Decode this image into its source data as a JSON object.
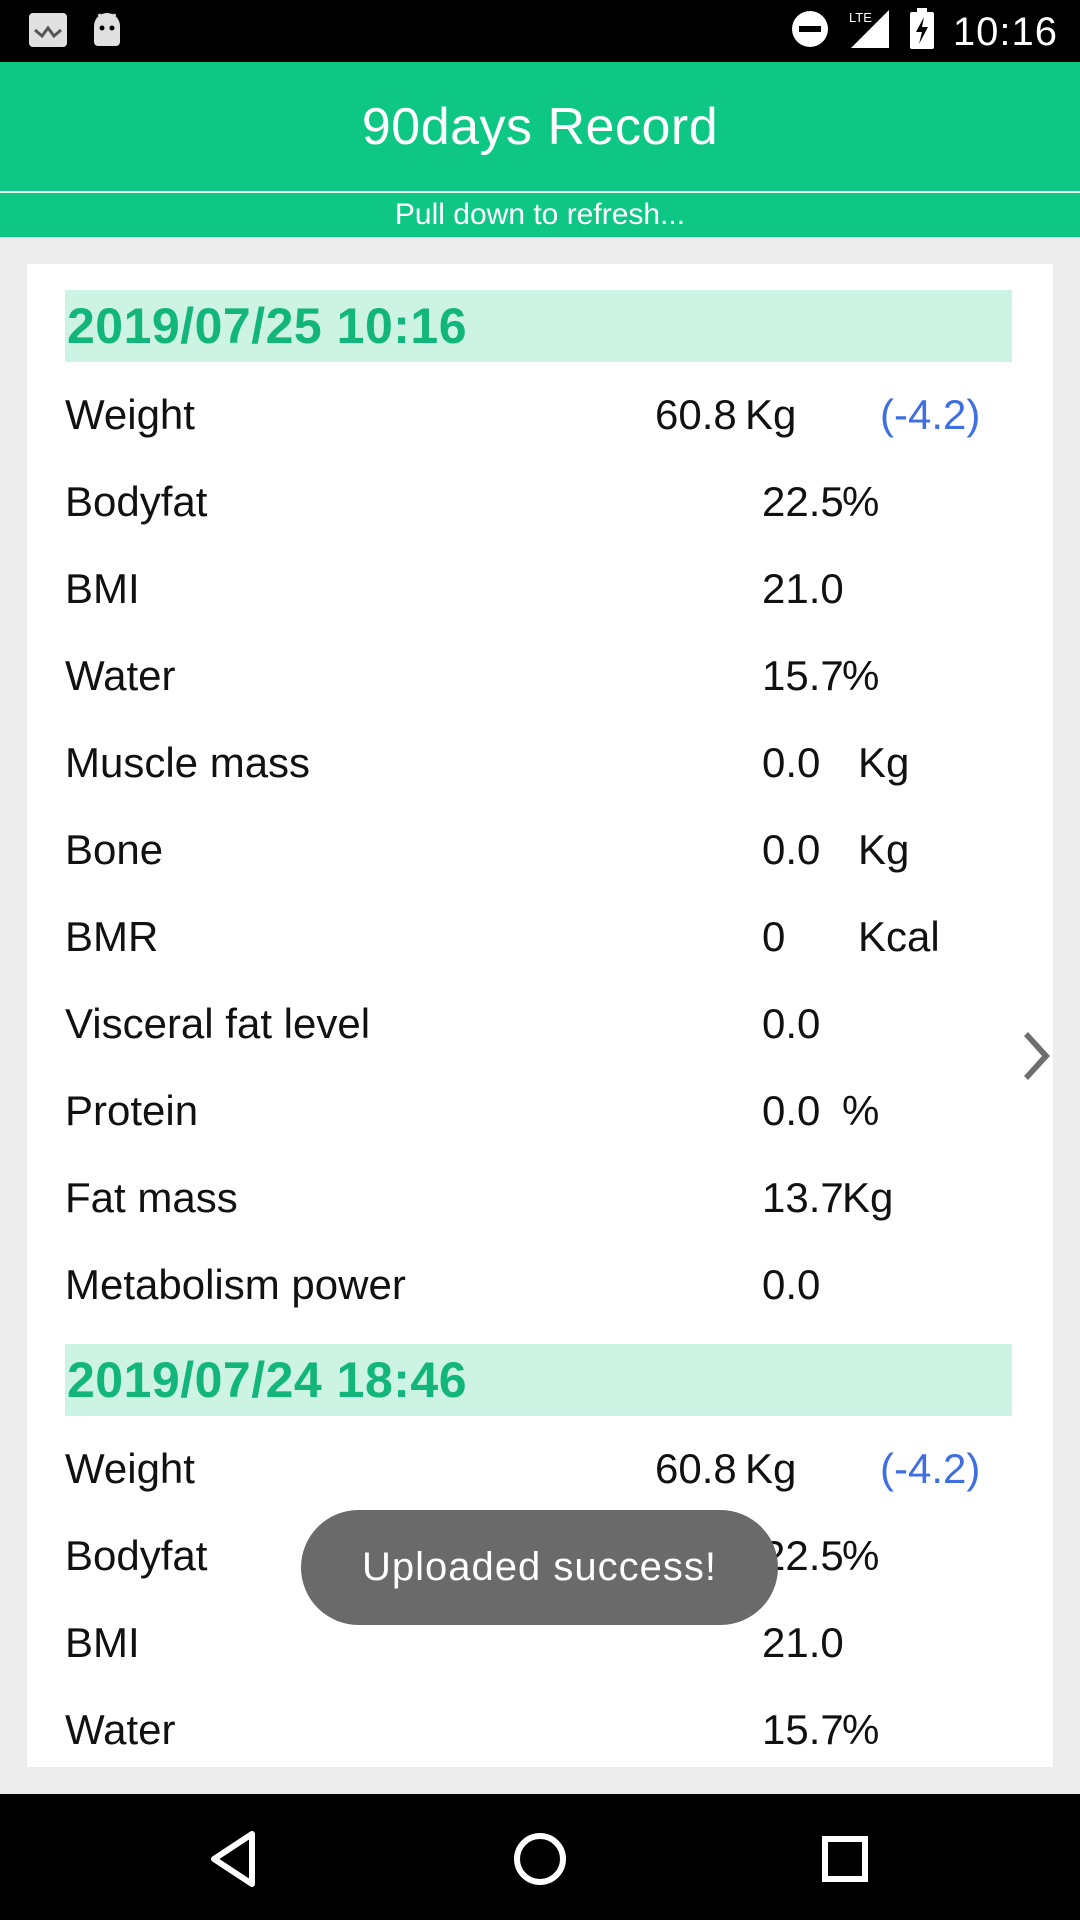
{
  "status_bar": {
    "time": "10:16",
    "network": "LTE",
    "icons": [
      "notification-app-icon",
      "android-icon",
      "do-not-disturb-icon",
      "lte-signal-icon",
      "battery-charging-icon"
    ]
  },
  "app_bar": {
    "title": "90days Record",
    "refresh_hint": "Pull down to refresh..."
  },
  "records": [
    {
      "date": "2019/07/25 10:16",
      "rows": [
        {
          "label": "Weight",
          "value": "60.8",
          "unit": "Kg",
          "delta": "(-4.2)"
        },
        {
          "label": "Bodyfat",
          "value": "22.5",
          "unit": "%"
        },
        {
          "label": "BMI",
          "value": "21.0",
          "unit": ""
        },
        {
          "label": "Water",
          "value": "15.7",
          "unit": "%"
        },
        {
          "label": "Muscle mass",
          "value": "0.0",
          "unit": "Kg"
        },
        {
          "label": "Bone",
          "value": "0.0",
          "unit": "Kg"
        },
        {
          "label": "BMR",
          "value": "0",
          "unit": "Kcal"
        },
        {
          "label": "Visceral fat level",
          "value": "0.0",
          "unit": ""
        },
        {
          "label": "Protein",
          "value": "0.0",
          "unit": "%"
        },
        {
          "label": "Fat mass",
          "value": "13.7",
          "unit": "Kg"
        },
        {
          "label": "Metabolism power",
          "value": "0.0",
          "unit": ""
        }
      ]
    },
    {
      "date": "2019/07/24 18:46",
      "rows": [
        {
          "label": "Weight",
          "value": "60.8",
          "unit": "Kg",
          "delta": "(-4.2)"
        },
        {
          "label": "Bodyfat",
          "value": "22.5",
          "unit": "%"
        },
        {
          "label": "BMI",
          "value": "21.0",
          "unit": ""
        },
        {
          "label": "Water",
          "value": "15.7",
          "unit": "%"
        }
      ]
    }
  ],
  "toast": {
    "message": "Uploaded success!"
  },
  "colors": {
    "accent": "#0fc785",
    "header_bg": "#ccf3e3",
    "date_text": "#12b57a",
    "delta_text": "#3f6fe0",
    "toast_bg": "#6a6a6a"
  }
}
